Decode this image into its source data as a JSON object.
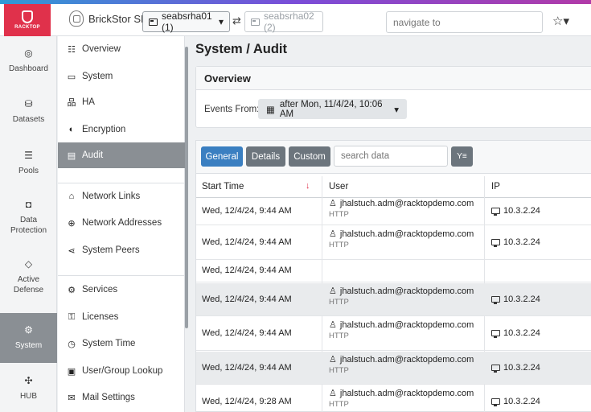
{
  "header": {
    "logo_text": "RACKTOP",
    "app_name": "BrickStor SP",
    "primary_host": "seabsrha01 (1)",
    "secondary_host": "seabsrha02 (2)",
    "navigate_placeholder": "navigate to",
    "swap_symbol": "⇄",
    "star_symbol": "☆▾",
    "caret": "▾"
  },
  "rail": [
    {
      "label": "Dashboard",
      "icon": "◎"
    },
    {
      "label": "Datasets",
      "icon": "⛁"
    },
    {
      "label": "Pools",
      "icon": "☰"
    },
    {
      "label": "Data Protection",
      "icon": "◘"
    },
    {
      "label": "Active Defense",
      "icon": "◇"
    },
    {
      "label": "System",
      "icon": "⚙"
    },
    {
      "label": "HUB",
      "icon": "✣"
    }
  ],
  "subnav": [
    {
      "label": "Overview",
      "icon": "☷"
    },
    {
      "label": "System",
      "icon": "▭"
    },
    {
      "label": "HA",
      "icon": "品"
    },
    {
      "label": "Encryption",
      "icon": "◐"
    },
    {
      "label": "Audit",
      "icon": "▤"
    },
    {
      "label": "Network Links",
      "icon": "⌂"
    },
    {
      "label": "Network Addresses",
      "icon": "⊕"
    },
    {
      "label": "System Peers",
      "icon": "⋖"
    },
    {
      "label": "Services",
      "icon": "⚙"
    },
    {
      "label": "Licenses",
      "icon": "⚿"
    },
    {
      "label": "System Time",
      "icon": "◷"
    },
    {
      "label": "User/Group Lookup",
      "icon": "▣"
    },
    {
      "label": "Mail Settings",
      "icon": "✉"
    }
  ],
  "main": {
    "page_title": "System / Audit",
    "overview_title": "Overview",
    "events_from_label": "Events From:",
    "events_from_value": "after Mon, 11/4/24, 10:06 AM",
    "calendar_icon": "▦"
  },
  "toolbar": {
    "general": "General",
    "details": "Details",
    "custom": "Custom",
    "search_placeholder": "search data",
    "filter_icon": "Y≡"
  },
  "table": {
    "columns": [
      "Start Time",
      "User",
      "IP"
    ],
    "sort_icon": "↓",
    "user_icon": "♙",
    "rows": [
      {
        "time": "Wed, 12/4/24, 9:44 AM",
        "user": "jhalstuch.adm@racktopdemo.com",
        "protocol": "HTTP",
        "ip": "10.3.2.24"
      },
      {
        "time": "Wed, 12/4/24, 9:44 AM",
        "user": "jhalstuch.adm@racktopdemo.com",
        "protocol": "HTTP",
        "ip": "10.3.2.24"
      },
      {
        "time": "Wed, 12/4/24, 9:44 AM",
        "user": "",
        "protocol": "",
        "ip": ""
      },
      {
        "time": "Wed, 12/4/24, 9:44 AM",
        "user": "jhalstuch.adm@racktopdemo.com",
        "protocol": "HTTP",
        "ip": "10.3.2.24"
      },
      {
        "time": "Wed, 12/4/24, 9:44 AM",
        "user": "jhalstuch.adm@racktopdemo.com",
        "protocol": "HTTP",
        "ip": "10.3.2.24"
      },
      {
        "time": "Wed, 12/4/24, 9:44 AM",
        "user": "jhalstuch.adm@racktopdemo.com",
        "protocol": "HTTP",
        "ip": "10.3.2.24"
      },
      {
        "time": "Wed, 12/4/24, 9:28 AM",
        "user": "jhalstuch.adm@racktopdemo.com",
        "protocol": "HTTP",
        "ip": "10.3.2.24"
      }
    ]
  },
  "colors": {
    "accent": "#3a7fc1",
    "brand": "#e0314b",
    "active": "#8a8f94"
  }
}
